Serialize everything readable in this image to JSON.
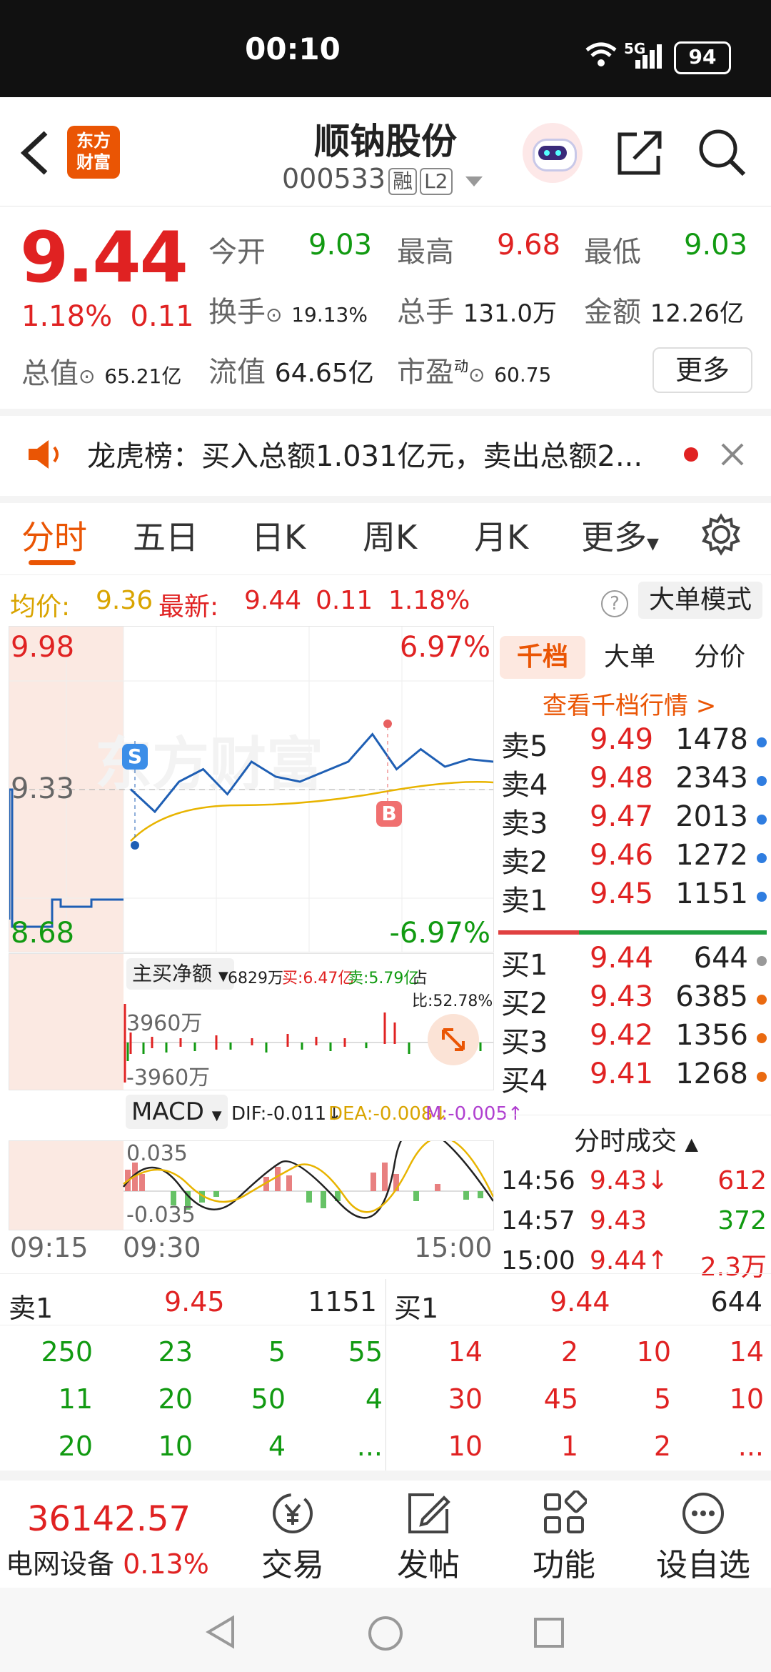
{
  "status": {
    "time": "00:10",
    "battery": "94",
    "network": "5G"
  },
  "header": {
    "logo_line1": "东方",
    "logo_line2": "财富",
    "name": "顺钠股份",
    "code": "000533",
    "tag1": "融",
    "tag2": "L2"
  },
  "quote": {
    "price": "9.44",
    "change_pct": "1.18%",
    "change": "0.11",
    "open_label": "今开",
    "open": "9.03",
    "high_label": "最高",
    "high": "9.68",
    "low_label": "最低",
    "low": "9.03",
    "turnover_label": "换手",
    "turnover": "19.13%",
    "volume_label": "总手",
    "volume": "131.0万",
    "amount_label": "金额",
    "amount": "12.26亿",
    "mktcap_label": "总值",
    "mktcap": "65.21亿",
    "float_label": "流值",
    "float_val": "64.65亿",
    "pe_label": "市盈",
    "pe_sup": "动",
    "pe": "60.75",
    "more": "更多"
  },
  "notice": {
    "text": "龙虎榜：买入总额1.031亿元，卖出总额2..."
  },
  "tabs": [
    "分时",
    "五日",
    "日K",
    "周K",
    "月K",
    "更多"
  ],
  "infobar": {
    "avg_label": "均价:",
    "avg": "9.36",
    "latest_label": "最新:",
    "latest": "9.44",
    "chg": "0.11",
    "pct": "1.18%",
    "mode_btn": "大单模式",
    "help": "?"
  },
  "chart": {
    "top_price": "9.98",
    "mid_price": "9.33",
    "bottom_price": "8.68",
    "top_pct": "6.97%",
    "bottom_pct": "-6.97%",
    "marker_s": "S",
    "marker_b": "B",
    "watermark": "东方财富",
    "flow_label": "主买净额",
    "flow_val": "6829万",
    "flow_buy": "买:6.47亿",
    "flow_sell": "卖:5.79亿",
    "flow_ratio": "占比:52.78%",
    "flow_top": "3960万",
    "flow_bottom": "-3960万",
    "macd_label": "MACD",
    "dif": "DIF:-0.011↓",
    "dea": "DEA:-0.008↓",
    "m": "M:-0.005↑",
    "macd_top": "0.035",
    "macd_bottom": "-0.035",
    "time_start": "09:15",
    "time_open": "09:30",
    "time_end": "15:00",
    "price_line": [
      9.33,
      9.24,
      9.36,
      9.41,
      9.31,
      9.44,
      9.38,
      9.36,
      9.4,
      9.44,
      9.55,
      9.41,
      9.49,
      9.42,
      9.45,
      9.44
    ]
  },
  "orderbook": {
    "tabs": [
      "千档",
      "大单",
      "分价"
    ],
    "link": "查看千档行情 >",
    "asks": [
      {
        "name": "卖5",
        "price": "9.49",
        "vol": "1478"
      },
      {
        "name": "卖4",
        "price": "9.48",
        "vol": "2343"
      },
      {
        "name": "卖3",
        "price": "9.47",
        "vol": "2013"
      },
      {
        "name": "卖2",
        "price": "9.46",
        "vol": "1272"
      },
      {
        "name": "卖1",
        "price": "9.45",
        "vol": "1151"
      }
    ],
    "bids": [
      {
        "name": "买1",
        "price": "9.44",
        "vol": "644"
      },
      {
        "name": "买2",
        "price": "9.43",
        "vol": "6385"
      },
      {
        "name": "买3",
        "price": "9.42",
        "vol": "1356"
      },
      {
        "name": "买4",
        "price": "9.41",
        "vol": "1268"
      }
    ],
    "trades_label": "分时成交",
    "trades": [
      {
        "time": "14:56",
        "price": "9.43↓",
        "vol": "612"
      },
      {
        "time": "14:57",
        "price": "9.43",
        "vol": "372"
      },
      {
        "time": "15:00",
        "price": "9.44↑",
        "vol": "2.3万"
      }
    ]
  },
  "queue": {
    "sell_label": "卖1",
    "sell_price": "9.45",
    "sell_vol": "1151",
    "buy_label": "买1",
    "buy_price": "9.44",
    "buy_vol": "644",
    "sell_rows": [
      [
        "250",
        "23",
        "5",
        "55"
      ],
      [
        "11",
        "20",
        "50",
        "4"
      ],
      [
        "20",
        "10",
        "4",
        "..."
      ]
    ],
    "buy_rows": [
      [
        "14",
        "2",
        "10",
        "14"
      ],
      [
        "30",
        "45",
        "5",
        "10"
      ],
      [
        "10",
        "1",
        "2",
        "..."
      ]
    ]
  },
  "bottom": {
    "index_val": "36142.57",
    "index_name": "电网设备",
    "index_pct": "0.13%",
    "trade": "交易",
    "post": "发帖",
    "func": "功能",
    "watch": "设自选"
  }
}
